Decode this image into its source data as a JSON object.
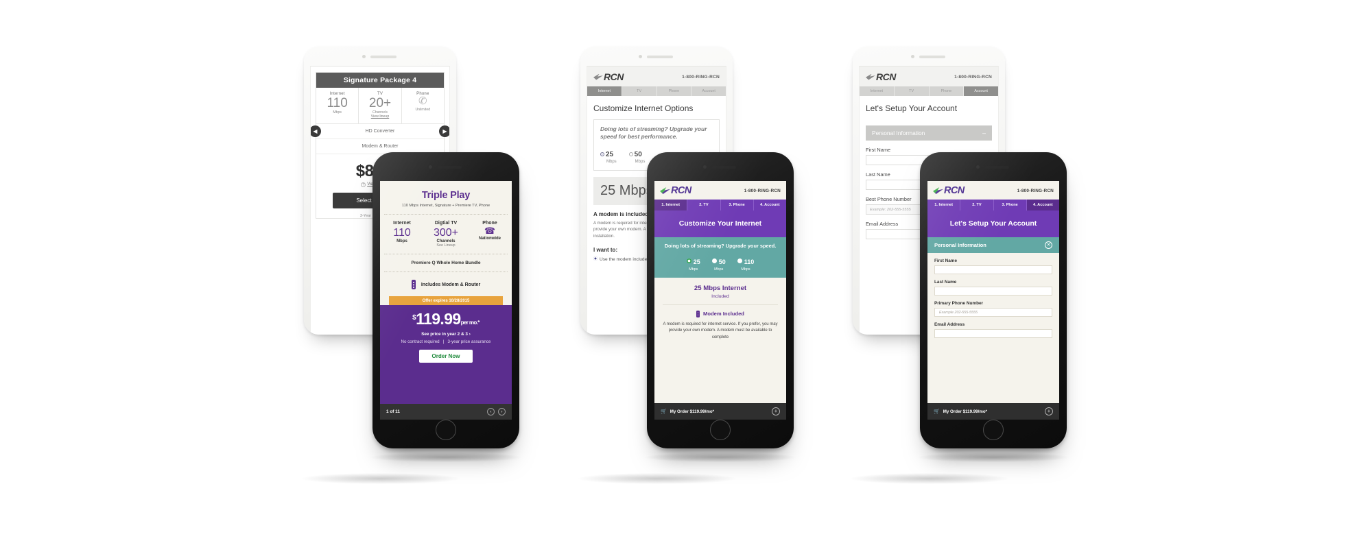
{
  "scene": {
    "background": "#ffffff",
    "accent_purple": "#5b2d8e",
    "accent_purple_light": "#6f3bb5",
    "accent_teal": "#62a8a4",
    "accent_orange": "#e8a33d",
    "accent_green": "#1f8a3b",
    "dark_bar": "#2f2f2f"
  },
  "tablet1": {
    "package": {
      "title": "Signature Package 4",
      "specs": [
        {
          "label": "Internet",
          "value": "110",
          "unit": "Mbps",
          "link": ""
        },
        {
          "label": "TV",
          "value": "20+",
          "unit": "Channels",
          "link": "View lineup"
        },
        {
          "label": "Phone",
          "value": "phone-icon",
          "unit": "Unlimited",
          "link": ""
        }
      ],
      "rows": [
        "HD Converter",
        "Modem & Router"
      ],
      "price": "$84.99",
      "view_details": "View price details",
      "select_button": "Select this package",
      "note": "3-Year Price Assurance",
      "prev_arrow": "◀",
      "next_arrow": "▶"
    }
  },
  "tablet2": {
    "header": {
      "logo": "RCN",
      "phone": "1-800-RING-RCN"
    },
    "tabs": [
      {
        "label": "Internet",
        "active": true
      },
      {
        "label": "TV",
        "active": false
      },
      {
        "label": "Phone",
        "active": false
      },
      {
        "label": "Account",
        "active": false
      }
    ],
    "heading": "Customize Internet Options",
    "upsell": "Doing lots of streaming? Upgrade your speed for best performance.",
    "speeds": [
      {
        "value": "25",
        "unit": "Mbps",
        "selected": true
      },
      {
        "value": "50",
        "unit": "Mbps",
        "selected": false
      }
    ],
    "band": "25 Mbps Internet",
    "modem_title": "A modem is included",
    "modem_text": "A modem is required for internet service. If you prefer, you may provide your own modem. A modem must be available to complete installation.",
    "want_title": "I want to:",
    "want_option": "Use the modem included"
  },
  "tablet3": {
    "header": {
      "logo": "RCN",
      "phone": "1-800-RING-RCN"
    },
    "tabs": [
      {
        "label": "Internet",
        "active": false
      },
      {
        "label": "TV",
        "active": false
      },
      {
        "label": "Phone",
        "active": false
      },
      {
        "label": "Account",
        "active": true
      }
    ],
    "heading": "Let's Setup Your Account",
    "section_title": "Personal Information",
    "collapse_icon": "–",
    "fields": [
      {
        "label": "First Name",
        "value": "",
        "placeholder": ""
      },
      {
        "label": "Last Name",
        "value": "",
        "placeholder": ""
      },
      {
        "label": "Best Phone Number",
        "value": "",
        "placeholder": "Example: 202-555-5555"
      },
      {
        "label": "Email Address",
        "value": "",
        "placeholder": ""
      }
    ]
  },
  "phone1": {
    "title": "Triple Play",
    "subtitle": "110 Mbps Internet, Signature + Premiere TV, Phone",
    "specs": [
      {
        "label": "Internet",
        "value": "110",
        "unit": "Mbps",
        "link": ""
      },
      {
        "label": "Digtial TV",
        "value": "300+",
        "unit": "Channels",
        "link": "See Lineup"
      },
      {
        "label": "Phone",
        "value": "phone-icon",
        "unit": "Nationwide",
        "link": ""
      }
    ],
    "bundle": "Premiere Q Whole Home Bundle",
    "modem_line": "Includes Modem & Router",
    "offer": "Offer expires 10/28/2015",
    "price": {
      "currency": "$",
      "amount": "119.99",
      "period": "per mo.*"
    },
    "year_link": "See price in year 2 & 3  ›",
    "terms_left": "No contract required",
    "terms_right": "3-year price assurance",
    "order_button": "Order Now",
    "pager": "1 of 11",
    "prev_arrow": "‹",
    "next_arrow": "›"
  },
  "phone2": {
    "header": {
      "logo": "RCN",
      "phone": "1-800-RING-RCN"
    },
    "tabs": [
      {
        "label": "1. Internet",
        "active": true
      },
      {
        "label": "2. TV",
        "active": false
      },
      {
        "label": "3. Phone",
        "active": false
      },
      {
        "label": "4. Account",
        "active": false
      }
    ],
    "hero": "Customize Your Internet",
    "upsell": "Doing lots of streaming? Upgrade your speed.",
    "speeds": [
      {
        "value": "25",
        "unit": "Mbps",
        "selected": true
      },
      {
        "value": "50",
        "unit": "Mbps",
        "selected": false
      },
      {
        "value": "110",
        "unit": "Mbps",
        "selected": false
      }
    ],
    "plan_title": "25 Mbps Internet",
    "plan_status": "Included",
    "modem_title": "Modem Included",
    "modem_text": "A modem is required for internet service. If you prefer, you may provide your own modem. A modem must be available to complete",
    "order_bar": {
      "label": "My Order $119.99/mo*",
      "cart_icon": "🛒",
      "plus": "+"
    }
  },
  "phone3": {
    "header": {
      "logo": "RCN",
      "phone": "1-800-RING-RCN"
    },
    "tabs": [
      {
        "label": "1. Internet",
        "active": false
      },
      {
        "label": "2. TV",
        "active": false
      },
      {
        "label": "3. Phone",
        "active": false
      },
      {
        "label": "4. Account",
        "active": true
      }
    ],
    "hero": "Let's Setup Your Account",
    "section_title": "Personal Information",
    "close_icon": "✕",
    "fields": [
      {
        "label": "First Name",
        "value": "",
        "placeholder": ""
      },
      {
        "label": "Last Name",
        "value": "",
        "placeholder": ""
      },
      {
        "label": "Primary Phone Number",
        "value": "",
        "placeholder": "Example  202-555-5555"
      },
      {
        "label": "Email Address",
        "value": "",
        "placeholder": ""
      }
    ],
    "order_bar": {
      "label": "My Order $119.99/mo*",
      "cart_icon": "🛒",
      "plus": "+"
    }
  }
}
